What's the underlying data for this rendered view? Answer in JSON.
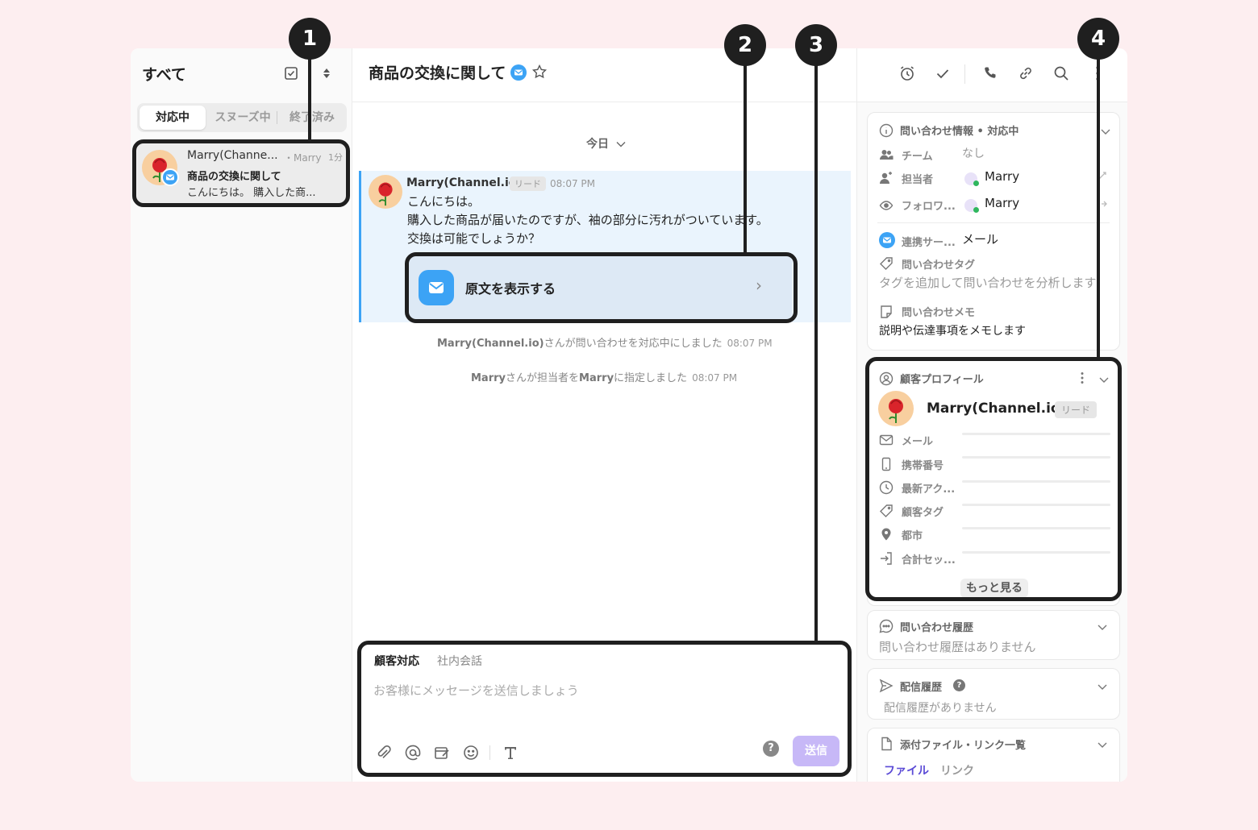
{
  "left_panel": {
    "title": "すべて",
    "tabs": [
      "対応中",
      "スヌーズ中",
      "終了済み"
    ],
    "conversation": {
      "name": "Marry(Channe...",
      "assignee": "・Marry",
      "time": "1分",
      "subject": "商品の交換に関して",
      "preview": "こんにちは。 購入した商..."
    }
  },
  "chat": {
    "title": "商品の交換に関して",
    "date_divider": "今日",
    "message": {
      "sender": "Marry(Channel.io)",
      "tag": "リード",
      "time": "08:07 PM",
      "lines": [
        "こんにちは。",
        "購入した商品が届いたのですが、袖の部分に汚れがついています。",
        "交換は可能でしょうか？"
      ]
    },
    "original_card_label": "原文を表示する",
    "system_messages": [
      {
        "actor": "Marry(Channel.io)",
        "text": "さんが問い合わせを対応中にしました",
        "time": "08:07 PM"
      },
      {
        "actor": "Marry",
        "text": "さんが担当者を",
        "target": "Marry",
        "tail": "に指定しました",
        "time": "08:07 PM"
      }
    ],
    "composer": {
      "tab_active": "顧客対応",
      "tab_inactive": "社内会話",
      "placeholder": "お客様にメッセージを送信しましょう",
      "send_label": "送信",
      "help": "?"
    }
  },
  "inquiry_info": {
    "title": "問い合わせ情報 • 対応中",
    "team_label": "チーム",
    "team_value": "なし",
    "assignee_label": "担当者",
    "assignee_value": "Marry",
    "follower_label": "フォロワ...",
    "follower_value": "Marry",
    "channel_label": "連携サー...",
    "channel_value": "メール",
    "tag_label": "問い合わせタグ",
    "tag_placeholder": "タグを追加して問い合わせを分析します",
    "memo_label": "問い合わせメモ",
    "memo_placeholder": "説明や伝達事項をメモします"
  },
  "customer_profile": {
    "title": "顧客プロフィール",
    "name": "Marry(Channel.io)",
    "tag": "リード",
    "fields": [
      "メール",
      "携帯番号",
      "最新アク...",
      "顧客タグ",
      "都市",
      "合計セッ..."
    ],
    "more_label": "もっと見る"
  },
  "inquiry_history": {
    "title": "問い合わせ履歴",
    "empty": "問い合わせ履歴はありません"
  },
  "delivery_history": {
    "title": "配信履歴",
    "empty": "配信履歴がありません"
  },
  "attachments": {
    "title": "添付ファイル・リンク一覧",
    "tab_files": "ファイル",
    "tab_links": "リンク"
  },
  "callouts": [
    "1",
    "2",
    "3",
    "4"
  ],
  "colors": {
    "accent": "#3ca3f5",
    "send": "#c7b8f7",
    "callout": "#1f1f1f",
    "page_bg": "#fdeef0"
  }
}
